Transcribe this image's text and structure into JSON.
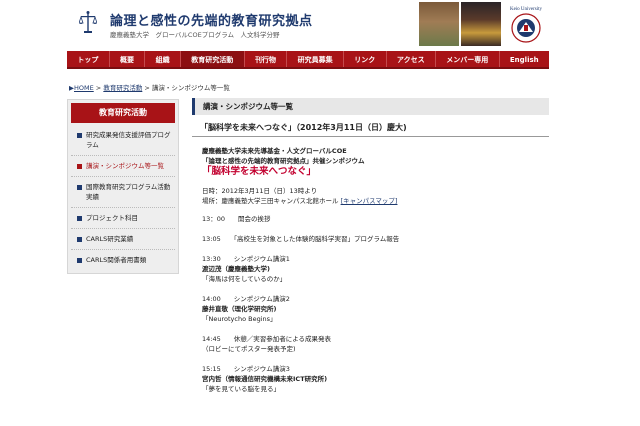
{
  "header": {
    "title": "論理と感性の先端的教育研究拠点",
    "subtitle": "慶應義塾大学　グローバルCOEプログラム　人文科学分野",
    "seal_text": "Keio University"
  },
  "nav": {
    "items": [
      "トップ",
      "概要",
      "組織",
      "教育研究活動",
      "刊行物",
      "研究員募集",
      "リンク",
      "アクセス",
      "メンバー専用",
      "English"
    ],
    "active_index": 3
  },
  "breadcrumb": {
    "home": "HOME",
    "separator": " > ",
    "parent": "教育研究活動",
    "current": "講演・シンポジウム等一覧"
  },
  "sidebar": {
    "header": "教育研究活動",
    "items": [
      {
        "label": "研究成果発信支援評価プログラム",
        "active": false
      },
      {
        "label": "講演・シンポジウム等一覧",
        "active": true
      },
      {
        "label": "国際教育研究プログラム活動実績",
        "active": false
      },
      {
        "label": "プロジェクト科目",
        "active": false
      },
      {
        "label": "CARLS研究業績",
        "active": false
      },
      {
        "label": "CARLS関係者用書類",
        "active": false
      }
    ]
  },
  "main": {
    "section_title": "講演・シンポジウム等一覧",
    "article_title": "「脳科学を未来へつなぐ」（2012年3月11日（日）慶大)",
    "sponsor_line1": "慶應義塾大学未来先導基金・人文グローバルCOE",
    "sponsor_line2": "「論理と感性の先端的教育研究拠点」共催シンポジウム",
    "event_title": "「脳科学を未来へつなぐ」",
    "date_line": "日時：2012年3月11日（日）13時より",
    "venue_line": "場所：慶應義塾大学三田キャンパス北館ホール",
    "map_link": "[キャンパスマップ]",
    "program": [
      {
        "line1": "13：00　　開会の挨拶"
      },
      {
        "line1": "13:05　　「高校生を対象とした体験的脳科学実習」プログラム報告"
      },
      {
        "line1": "13:30　　シンポジウム講演1",
        "speaker": "渡辺茂（慶應義塾大学)",
        "topic": "「海馬は何をしているのか」"
      },
      {
        "line1": "14:00　　シンポジウム講演2",
        "speaker": "藤井直敬（理化学研究所)",
        "topic": "「Neurotycho Begins」"
      },
      {
        "line1": "14:45　　休憩／実習参加者による成果発表",
        "speaker_plain": "（ロビーにてポスター発表予定)"
      },
      {
        "line1": "15:15　　シンポジウム講演3",
        "speaker": "宮内哲（情報通信研究機構未来ICT研究所)",
        "topic": "「夢を見ている脳を見る」"
      }
    ]
  },
  "colors": {
    "nav_red": "#a81317",
    "title_blue": "#1f3a6e",
    "event_red": "#c2002f"
  }
}
